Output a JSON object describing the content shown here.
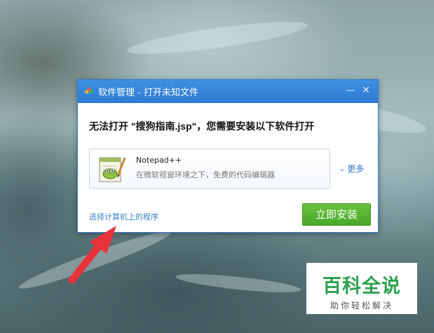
{
  "dialog": {
    "title": "软件管理 - 打开未知文件",
    "headline": "无法打开 \"搜狗指南.jsp\"，您需要安装以下软件打开",
    "software": {
      "name": "Notepad++",
      "description": "在微软视窗环境之下，免费的代码编辑器",
      "icon": "notepad-plus-plus-icon"
    },
    "more_label": "更多",
    "choose_program_label": "选择计算机上的程序",
    "install_label": "立即安装",
    "minimize_symbol": "—",
    "close_symbol": "✕"
  },
  "watermark": {
    "title": "百科全说",
    "subtitle": "助你轻松解决"
  },
  "colors": {
    "titlebar": "#2f7bd2",
    "install_button": "#4aa82a",
    "link": "#3a86cf",
    "arrow": "#e8333a",
    "watermark_green": "#2da14f"
  }
}
